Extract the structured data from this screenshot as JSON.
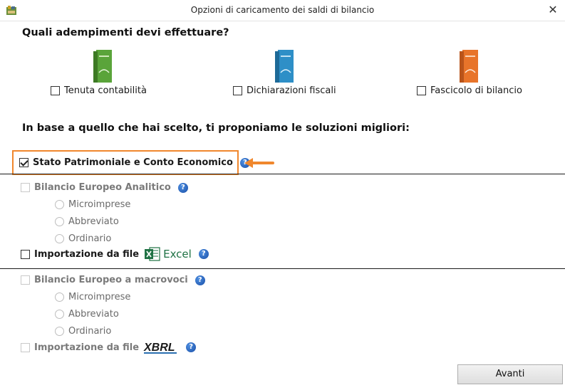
{
  "window": {
    "title": "Opzioni di caricamento dei saldi di bilancio",
    "close_glyph": "✕",
    "app_icon": "app-icon"
  },
  "question": "Quali adempimenti devi effettuare?",
  "products": [
    {
      "label": "Tenuta contabilità",
      "checked": false,
      "color": "#5aa43a"
    },
    {
      "label": "Dichiarazioni fiscali",
      "checked": false,
      "color": "#2e8fc7"
    },
    {
      "label": "Fascicolo di bilancio",
      "checked": false,
      "color": "#e8742a"
    }
  ],
  "suggestion": "In base a quello che hai scelto, ti proponiamo le soluzioni migliori:",
  "highlight_color": "#f0872d",
  "stato_patrimoniale": {
    "label": "Stato Patrimoniale e Conto Economico",
    "checked": true
  },
  "bilancio_analitico": {
    "label": "Bilancio Europeo Analitico",
    "options": [
      "Microimprese",
      "Abbreviato",
      "Ordinario"
    ],
    "import_label": "Importazione da file",
    "import_logo": "Excel"
  },
  "bilancio_macrovoci": {
    "label": "Bilancio Europeo a macrovoci",
    "options": [
      "Microimprese",
      "Abbreviato",
      "Ordinario"
    ],
    "import_label": "Importazione da file",
    "import_logo": "XBRL"
  },
  "help_glyph": "?",
  "buttons": {
    "next": "Avanti"
  }
}
